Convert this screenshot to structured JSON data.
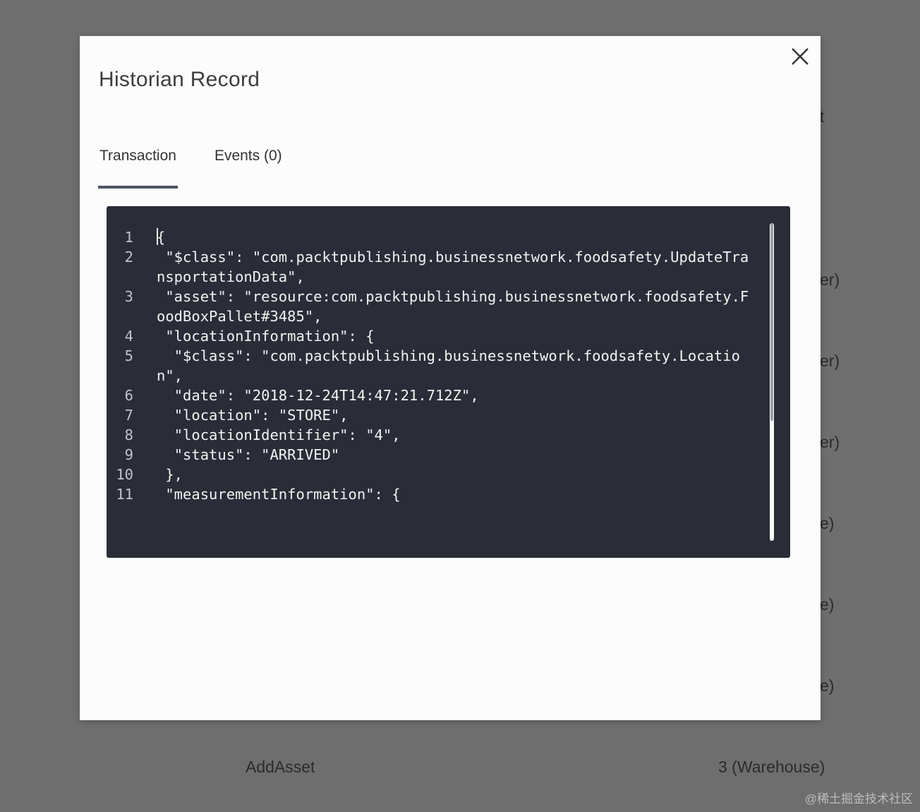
{
  "background": {
    "edge_rows": [
      "t",
      "er)",
      "er)",
      "er)",
      "e)",
      "e)",
      "e)"
    ],
    "bottom_row": {
      "left": "AddAsset",
      "right": "3 (Warehouse)"
    },
    "watermark": "@稀土掘金技术社区"
  },
  "modal": {
    "title": "Historian Record",
    "close_icon": "close-icon",
    "tabs": [
      {
        "label": "Transaction",
        "active": true
      },
      {
        "label": "Events (0)",
        "active": false
      }
    ]
  },
  "editor": {
    "lines": [
      {
        "num": "1",
        "text": "{"
      },
      {
        "num": "2",
        "text": " \"$class\": \"com.packtpublishing.businessnetwork.foodsafety.UpdateTransportationData\","
      },
      {
        "num": "3",
        "text": " \"asset\": \"resource:com.packtpublishing.businessnetwork.foodsafety.FoodBoxPallet#3485\","
      },
      {
        "num": "4",
        "text": " \"locationInformation\": {"
      },
      {
        "num": "5",
        "text": "  \"$class\": \"com.packtpublishing.businessnetwork.foodsafety.Location\","
      },
      {
        "num": "6",
        "text": "  \"date\": \"2018-12-24T14:47:21.712Z\","
      },
      {
        "num": "7",
        "text": "  \"location\": \"STORE\","
      },
      {
        "num": "8",
        "text": "  \"locationIdentifier\": \"4\","
      },
      {
        "num": "9",
        "text": "  \"status\": \"ARRIVED\""
      },
      {
        "num": "10",
        "text": " },"
      },
      {
        "num": "11",
        "text": " \"measurementInformation\": {"
      }
    ]
  },
  "colors": {
    "overlay": "#6e6e6e",
    "modal_bg": "#fcfcfc",
    "editor_bg": "#2a2d37",
    "tab_indicator": "#4b5462"
  }
}
